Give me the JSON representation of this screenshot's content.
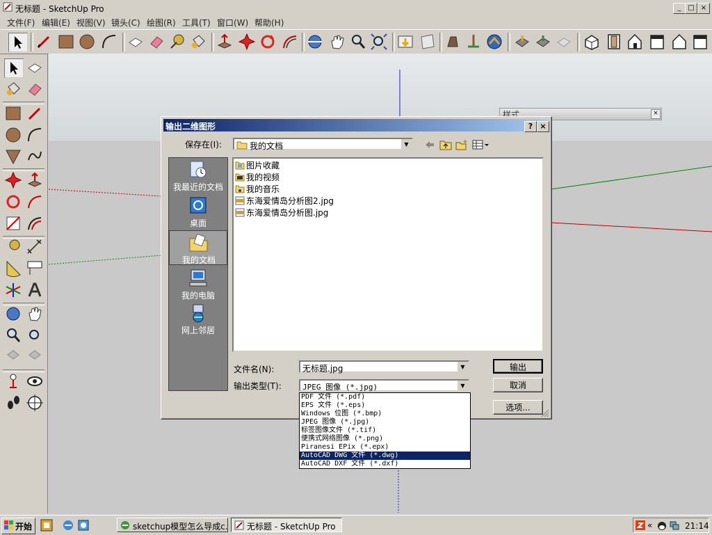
{
  "window": {
    "title": "无标题 - SketchUp Pro",
    "min_label": "_",
    "max_label": "□",
    "close_label": "×"
  },
  "menu": [
    "文件(F)",
    "编辑(E)",
    "视图(V)",
    "镜头(C)",
    "绘图(R)",
    "工具(T)",
    "窗口(W)",
    "帮助(H)"
  ],
  "style_panel": {
    "title": "样式"
  },
  "dialog": {
    "title": "输出二维图形",
    "help_label": "?",
    "close_label": "×",
    "save_in_label": "保存在(I):",
    "save_in_value": "我的文档",
    "places": [
      {
        "label": "我最近的文档",
        "icon": "recent-docs-icon"
      },
      {
        "label": "桌面",
        "icon": "desktop-icon"
      },
      {
        "label": "我的文档",
        "icon": "my-documents-icon"
      },
      {
        "label": "我的电脑",
        "icon": "my-computer-icon"
      },
      {
        "label": "网上邻居",
        "icon": "network-icon"
      }
    ],
    "files": [
      {
        "name": "图片收藏",
        "type": "folder"
      },
      {
        "name": "我的视频",
        "type": "folder"
      },
      {
        "name": "我的音乐",
        "type": "folder"
      },
      {
        "name": "东海爱情岛分析图2.jpg",
        "type": "jpg"
      },
      {
        "name": "东海爱情岛分析图.jpg",
        "type": "jpg"
      }
    ],
    "filename_label": "文件名(N):",
    "filename_value": "无标题.jpg",
    "filetype_label": "输出类型(T):",
    "filetype_value": "JPEG 图像 (*.jpg)",
    "export_button": "输出",
    "cancel_button": "取消",
    "options_button": "选项...",
    "filetype_options": [
      "PDF 文件 (*.pdf)",
      "EPS 文件 (*.eps)",
      "Windows 位图 (*.bmp)",
      "JPEG 图像 (*.jpg)",
      "标签图像文件 (*.tif)",
      "便携式网络图像 (*.png)",
      "Piranesi EPix (*.epx)",
      "AutoCAD DWG 文件 (*.dwg)",
      "AutoCAD DXF 文件 (*.dxf)"
    ],
    "selected_filetype": "AutoCAD DWG 文件 (*.dwg)"
  },
  "taskbar": {
    "start_label": "开始",
    "tasks": [
      "sketchup模型怎么导成c...",
      "无标题 - SketchUp Pro"
    ],
    "active_task": "无标题 - SketchUp Pro",
    "clock": "21:14"
  },
  "colors": {
    "title_active": "#0a246a",
    "axis_blue": "#1c1cd8",
    "axis_red": "#c00000",
    "axis_green": "#008a00"
  }
}
